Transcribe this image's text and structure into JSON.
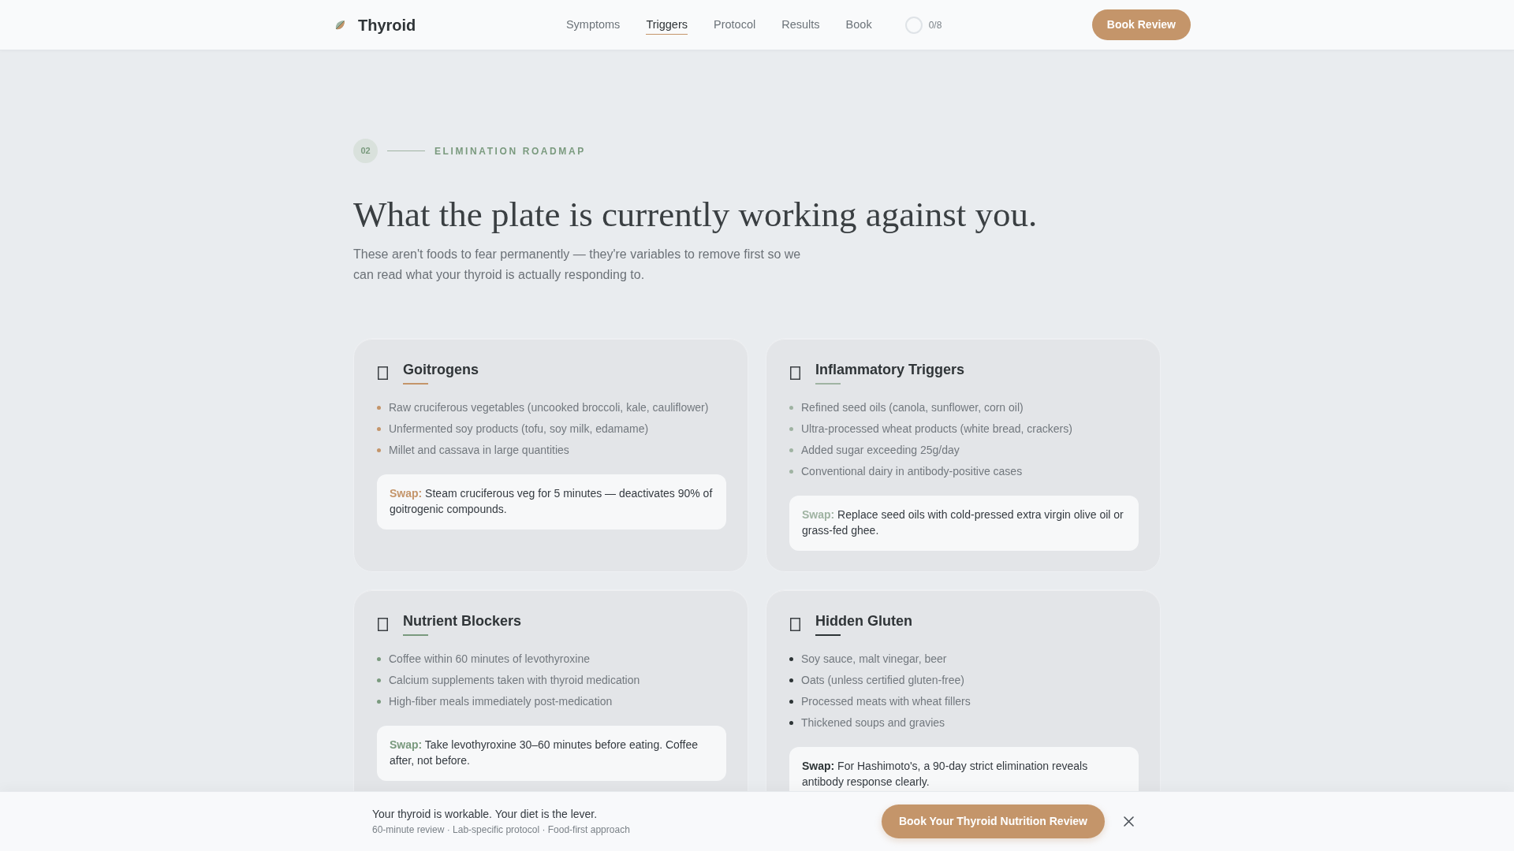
{
  "header": {
    "brand": "Thyroid",
    "nav": [
      {
        "label": "Symptoms",
        "selected": false
      },
      {
        "label": "Triggers",
        "selected": true
      },
      {
        "label": "Protocol",
        "selected": false
      },
      {
        "label": "Results",
        "selected": false
      },
      {
        "label": "Book",
        "selected": false
      }
    ],
    "progress": {
      "level": 0,
      "label": "0/8"
    },
    "cta": "Book Review"
  },
  "section": {
    "number": "02",
    "eyebrow": "ELIMINATION ROADMAP",
    "title": "What the plate is currently working against you.",
    "intro": "These aren't foods to fear permanently — they're variables to remove first so we can read what your thyroid is actually responding to."
  },
  "cards": [
    {
      "title": "Goitrogens",
      "color": "#c4956a",
      "items": [
        "Raw cruciferous vegetables (uncooked broccoli, kale, cauliflower)",
        "Unfermented soy products (tofu, soy milk, edamame)",
        "Millet and cassava in large quantities"
      ],
      "swap": "**Swap:** Steam cruciferous veg for 5 minutes — deactivates 90% of goitrogenic compounds."
    },
    {
      "title": "Inflammatory Triggers",
      "color": "#9fb3a2",
      "items": [
        "Refined seed oils (canola, sunflower, corn oil)",
        "Ultra-processed wheat products (white bread, crackers)",
        "Added sugar exceeding 25g/day",
        "Conventional dairy in antibody-positive cases"
      ],
      "swap": "**Swap:** Replace seed oils with cold-pressed extra virgin olive oil or grass-fed ghee."
    },
    {
      "title": "Nutrient Blockers",
      "color": "#7a9a7e",
      "items": [
        "Coffee within 60 minutes of levothyroxine",
        "Calcium supplements taken with thyroid medication",
        "High-fiber meals immediately post-medication"
      ],
      "swap": "**Swap:** Take levothyroxine 30–60 minutes before eating. Coffee after, not before."
    },
    {
      "title": "Hidden Gluten",
      "color": "#2d3436",
      "items": [
        "Soy sauce, malt vinegar, beer",
        "Oats (unless certified gluten-free)",
        "Processed meats with wheat fillers",
        "Thickened soups and gravies"
      ],
      "swap": "**Swap:** For Hashimoto's, a 90-day strict elimination reveals antibody response clearly."
    }
  ],
  "bottom_bar": {
    "headline": "Your thyroid is workable. Your diet is the lever.",
    "details": "60-minute review · Lab-specific protocol · Food-first approach",
    "button": "Book Your Thyroid Nutrition Review"
  }
}
